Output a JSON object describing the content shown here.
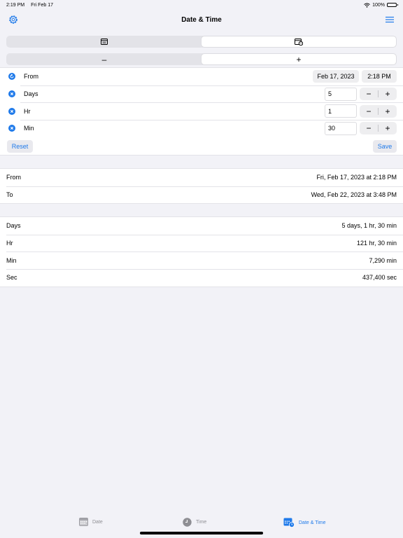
{
  "status": {
    "time": "2:19 PM",
    "date": "Fri Feb 17",
    "battery": "100%"
  },
  "nav": {
    "title": "Date & Time",
    "left_icon": "gear-icon",
    "right_icon": "menu-icon"
  },
  "mode_segment": {
    "icons": [
      "calendar-icon",
      "calendar-clock-icon"
    ],
    "selected": 1
  },
  "op_segment": {
    "labels": [
      "–",
      "+"
    ],
    "selected": 1
  },
  "inputs": {
    "from": {
      "label": "From",
      "date": "Feb 17, 2023",
      "time": "2:18 PM"
    },
    "rows": [
      {
        "label": "Days",
        "value": "5"
      },
      {
        "label": "Hr",
        "value": "1"
      },
      {
        "label": "Min",
        "value": "30"
      }
    ],
    "minus": "−",
    "plus": "+",
    "reset": "Reset",
    "save": "Save"
  },
  "range": [
    {
      "label": "From",
      "value": "Fri, Feb 17, 2023 at 2:18 PM"
    },
    {
      "label": "To",
      "value": "Wed, Feb 22, 2023 at 3:48 PM"
    }
  ],
  "durations": [
    {
      "label": "Days",
      "value": "5 days, 1 hr, 30 min"
    },
    {
      "label": "Hr",
      "value": "121 hr, 30 min"
    },
    {
      "label": "Min",
      "value": "7,290 min"
    },
    {
      "label": "Sec",
      "value": "437,400 sec"
    }
  ],
  "tabs": [
    {
      "label": "Date",
      "icon": "calendar-icon"
    },
    {
      "label": "Time",
      "icon": "clock-icon"
    },
    {
      "label": "Date & Time",
      "icon": "calendar-clock-icon"
    }
  ],
  "colors": {
    "accent": "#1f7aea",
    "background": "#f2f2f7",
    "inactive": "#8e8e93"
  }
}
